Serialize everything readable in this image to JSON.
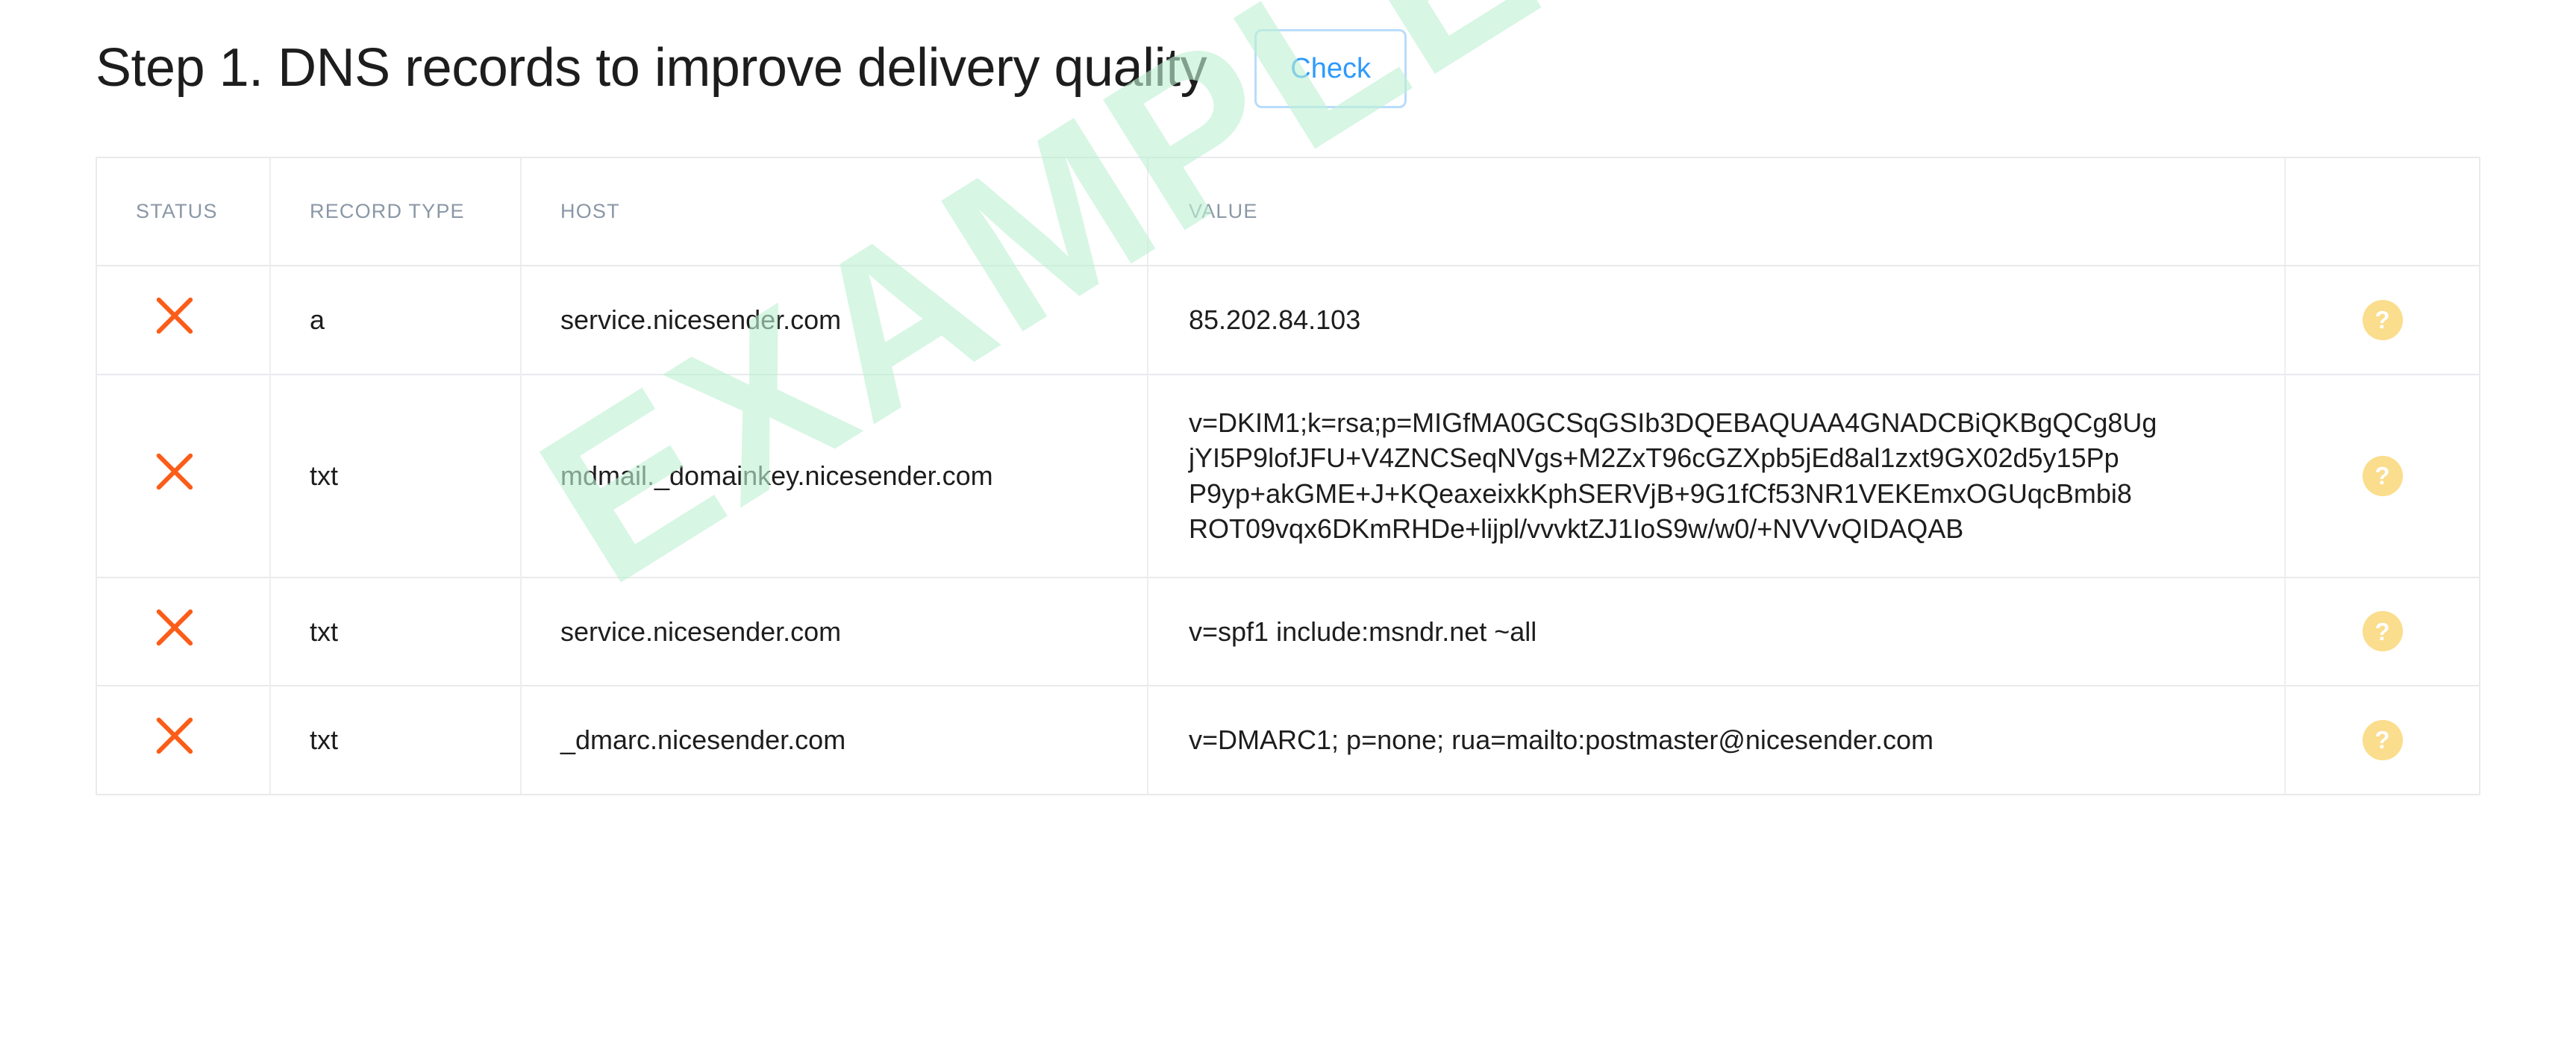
{
  "header": {
    "title": "Step 1. DNS records to improve delivery quality",
    "check_label": "Check"
  },
  "watermark": {
    "text": "EXAMPLE",
    "color": "#bff1d3"
  },
  "colors": {
    "accent_blue": "#2f9afc",
    "button_border": "#b9dcfb",
    "status_error": "#fb5d19",
    "help_badge": "#fadd8d",
    "border": "#e8eaec",
    "header_text": "#8a97a6"
  },
  "table": {
    "columns": [
      {
        "key": "status",
        "label": "STATUS"
      },
      {
        "key": "record_type",
        "label": "RECORD TYPE"
      },
      {
        "key": "host",
        "label": "HOST"
      },
      {
        "key": "value",
        "label": "VALUE"
      },
      {
        "key": "help",
        "label": ""
      }
    ],
    "rows": [
      {
        "status": "error",
        "status_icon": "x-icon",
        "record_type": "a",
        "host": "service.nicesender.com",
        "value": "85.202.84.103",
        "value_lines": [
          "85.202.84.103"
        ],
        "help_icon": "question-mark-icon",
        "help_label": "?"
      },
      {
        "status": "error",
        "status_icon": "x-icon",
        "record_type": "txt",
        "host": "mdmail._domainkey.nicesender.com",
        "value": "v=DKIM1;k=rsa;p=MIGfMA0GCSqGSIb3DQEBAQUAA4GNADCBiQKBgQCg8UgjYI5P9lofJFU+V4ZNCSeqNVgs+M2ZxT96cGZXpb5jEd8al1zxt9GX02d5y15PpP9yp+akGME+J+KQeaxeixkKphSERVjB+9G1fCf53NR1VEKEmxOGUqcBmbi8ROT09vqx6DKmRHDe+lijpl/vvvktZJ1IoS9w/w0/+NVVvQIDAQAB",
        "value_lines": [
          "v=DKIM1;k=rsa;p=MIGfMA0GCSqGSIb3DQEBAQUAA4GNADCBiQKBgQCg8Ug",
          "jYI5P9lofJFU+V4ZNCSeqNVgs+M2ZxT96cGZXpb5jEd8al1zxt9GX02d5y15Pp",
          "P9yp+akGME+J+KQeaxeixkKphSERVjB+9G1fCf53NR1VEKEmxOGUqcBmbi8",
          "ROT09vqx6DKmRHDe+lijpl/vvvktZJ1IoS9w/w0/+NVVvQIDAQAB"
        ],
        "help_icon": "question-mark-icon",
        "help_label": "?"
      },
      {
        "status": "error",
        "status_icon": "x-icon",
        "record_type": "txt",
        "host": "service.nicesender.com",
        "value": "v=spf1 include:msndr.net ~all",
        "value_lines": [
          "v=spf1 include:msndr.net ~all"
        ],
        "help_icon": "question-mark-icon",
        "help_label": "?"
      },
      {
        "status": "error",
        "status_icon": "x-icon",
        "record_type": "txt",
        "host": "_dmarc.nicesender.com",
        "value": "v=DMARC1; p=none; rua=mailto:postmaster@nicesender.com",
        "value_lines": [
          "v=DMARC1; p=none; rua=mailto:postmaster@nicesender.com"
        ],
        "help_icon": "question-mark-icon",
        "help_label": "?"
      }
    ]
  }
}
